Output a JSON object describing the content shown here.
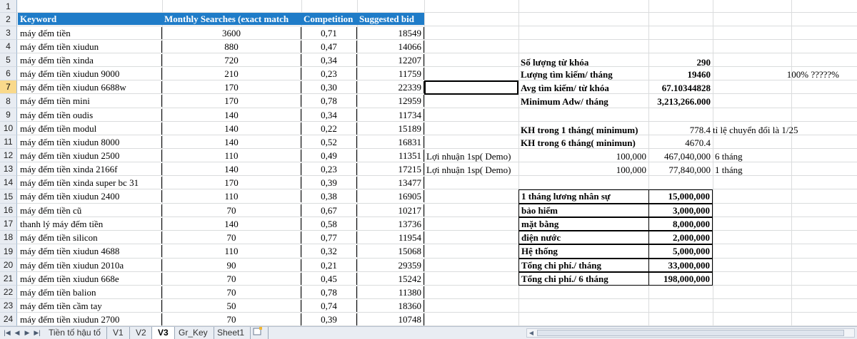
{
  "sheet": {
    "row_numbers": [
      "1",
      "2",
      "3",
      "4",
      "5",
      "6",
      "7",
      "8",
      "9",
      "10",
      "11",
      "12",
      "13",
      "14",
      "15",
      "16",
      "17",
      "18",
      "19",
      "20",
      "21",
      "22",
      "23",
      "24"
    ],
    "selected_row": "7",
    "table": {
      "headers": [
        "Keyword",
        "Monthly Searches (exact match",
        "Competition",
        "Suggested bid"
      ],
      "rows": [
        [
          "máy đếm tiền",
          "3600",
          "0,71",
          "18549"
        ],
        [
          "máy đếm tiền xiudun",
          "880",
          "0,47",
          "14066"
        ],
        [
          "máy đếm tiền xinda",
          "720",
          "0,34",
          "12207"
        ],
        [
          "máy đếm tiền xiudun 9000",
          "210",
          "0,23",
          "11759"
        ],
        [
          "máy đếm tiền xiudun 6688w",
          "170",
          "0,30",
          "22339"
        ],
        [
          "máy đếm tiền mini",
          "170",
          "0,78",
          "12959"
        ],
        [
          "máy đếm tiền oudis",
          "140",
          "0,34",
          "11734"
        ],
        [
          "máy đếm tiền modul",
          "140",
          "0,22",
          "15189"
        ],
        [
          "máy đếm tiền xiudun 8000",
          "140",
          "0,52",
          "16831"
        ],
        [
          "máy đếm tiền xiudun 2500",
          "110",
          "0,49",
          "11351"
        ],
        [
          "máy đếm tiền xinda 2166f",
          "140",
          "0,23",
          "17215"
        ],
        [
          "máy đếm tiền xinda super bc 31",
          "170",
          "0,39",
          "13477"
        ],
        [
          "máy đếm tiền xiudun 2400",
          "110",
          "0,38",
          "16905"
        ],
        [
          "máy đếm tiền cũ",
          "70",
          "0,67",
          "10217"
        ],
        [
          "thanh lý máy đếm tiền",
          "140",
          "0,58",
          "13736"
        ],
        [
          "máy đếm tiền silicon",
          "70",
          "0,77",
          "11954"
        ],
        [
          "máy đếm tiền xiudun 4688",
          "110",
          "0,32",
          "15068"
        ],
        [
          "máy đếm tiền xiudun 2010a",
          "90",
          "0,21",
          "29359"
        ],
        [
          "máy đếm tiền xiudun 668e",
          "70",
          "0,45",
          "15242"
        ],
        [
          "máy đếm tiền balion",
          "70",
          "0,78",
          "11380"
        ],
        [
          "máy đếm tiền cầm tay",
          "50",
          "0,74",
          "18360"
        ],
        [
          "máy đếm tiền xiudun 2700",
          "70",
          "0,39",
          "10748"
        ]
      ]
    },
    "summary": {
      "so_luong_label": "Số lượng từ khóa",
      "so_luong_value": "290",
      "luong_tim_label": "Lượng tìm kiếm/ tháng",
      "luong_tim_value": "19460",
      "luong_tim_pct": "100% ?????%",
      "avg_label": "Avg tìm kiếm/ từ khóa",
      "avg_value": "67.10344828",
      "min_adw_label": "Minimum Adw/ tháng",
      "min_adw_value": "3,213,266.000",
      "kh1_label": "KH trong 1 tháng( minimum)",
      "kh1_value": "778.4",
      "kh1_note": "tỉ lệ chuyển đổi là 1/25",
      "kh6_label": "KH trong 6 tháng( minimun)",
      "kh6_value": "4670.4",
      "ln1_label": "Lợi nhuận 1sp( Demo)",
      "ln1_value": "100,000",
      "ln1_total": "467,040,000",
      "ln1_period": "6 tháng",
      "ln2_label": "Lợi nhuận 1sp( Demo)",
      "ln2_value": "100,000",
      "ln2_total": "77,840,000",
      "ln2_period": "1 tháng"
    },
    "costs": [
      [
        "1 tháng lương nhân sự",
        "15,000,000"
      ],
      [
        "bảo hiểm",
        "3,000,000"
      ],
      [
        "mặt bằng",
        "8,000,000"
      ],
      [
        "điện nước",
        "2,000,000"
      ],
      [
        "Hệ thống",
        "5,000,000"
      ],
      [
        "Tổng chi phí./ tháng",
        "33,000,000"
      ],
      [
        "Tổng chi phí./ 6 tháng",
        "198,000,000"
      ]
    ]
  },
  "tabs": {
    "nav_icons": [
      "first-sheet-icon",
      "prev-sheet-icon",
      "next-sheet-icon",
      "last-sheet-icon"
    ],
    "items": [
      "Tiền tố hậu tố",
      "V1",
      "V2",
      "V3",
      "Gr_Key",
      "Sheet1"
    ],
    "active": "V3",
    "new_sheet_icon": "insert-sheet-icon"
  },
  "colors": {
    "header_fill": "#1f7cc8",
    "selected_row_header": "#f9d98b"
  }
}
